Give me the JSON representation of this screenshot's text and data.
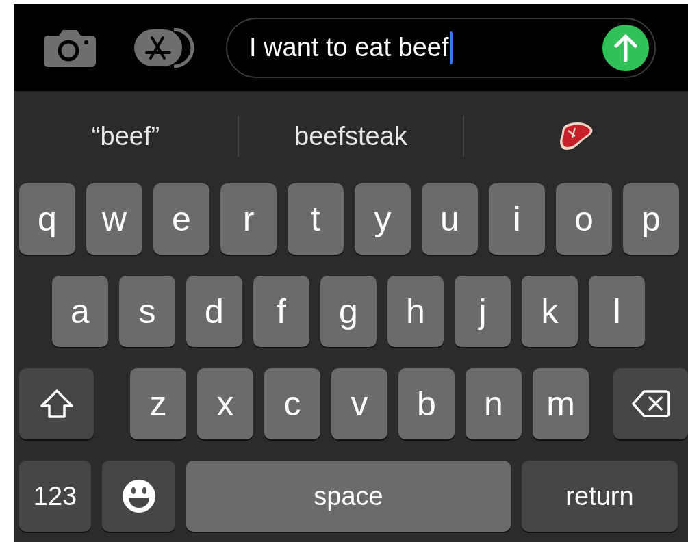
{
  "message_bar": {
    "value": "I want to eat beef"
  },
  "suggestions": [
    {
      "kind": "text",
      "label": "“beef”"
    },
    {
      "kind": "text",
      "label": "beefsteak"
    },
    {
      "kind": "emoji"
    }
  ],
  "keyboard": {
    "rows": [
      {
        "keys": [
          {
            "kind": "letter",
            "label": "q"
          },
          {
            "kind": "letter",
            "label": "w"
          },
          {
            "kind": "letter",
            "label": "e"
          },
          {
            "kind": "letter",
            "label": "r"
          },
          {
            "kind": "letter",
            "label": "t"
          },
          {
            "kind": "letter",
            "label": "y"
          },
          {
            "kind": "letter",
            "label": "u"
          },
          {
            "kind": "letter",
            "label": "i"
          },
          {
            "kind": "letter",
            "label": "o"
          },
          {
            "kind": "letter",
            "label": "p"
          }
        ]
      },
      {
        "keys": [
          {
            "kind": "letter",
            "label": "a"
          },
          {
            "kind": "letter",
            "label": "s"
          },
          {
            "kind": "letter",
            "label": "d"
          },
          {
            "kind": "letter",
            "label": "f"
          },
          {
            "kind": "letter",
            "label": "g"
          },
          {
            "kind": "letter",
            "label": "h"
          },
          {
            "kind": "letter",
            "label": "j"
          },
          {
            "kind": "letter",
            "label": "k"
          },
          {
            "kind": "letter",
            "label": "l"
          }
        ]
      },
      {
        "keys": [
          {
            "kind": "shift"
          },
          {
            "kind": "letter",
            "label": "z"
          },
          {
            "kind": "letter",
            "label": "x"
          },
          {
            "kind": "letter",
            "label": "c"
          },
          {
            "kind": "letter",
            "label": "v"
          },
          {
            "kind": "letter",
            "label": "b"
          },
          {
            "kind": "letter",
            "label": "n"
          },
          {
            "kind": "letter",
            "label": "m"
          },
          {
            "kind": "delete"
          }
        ]
      },
      {
        "keys": [
          {
            "kind": "numbers",
            "label": "123"
          },
          {
            "kind": "emoji"
          },
          {
            "kind": "space",
            "label": "space"
          },
          {
            "kind": "return",
            "label": "return"
          }
        ]
      }
    ]
  }
}
